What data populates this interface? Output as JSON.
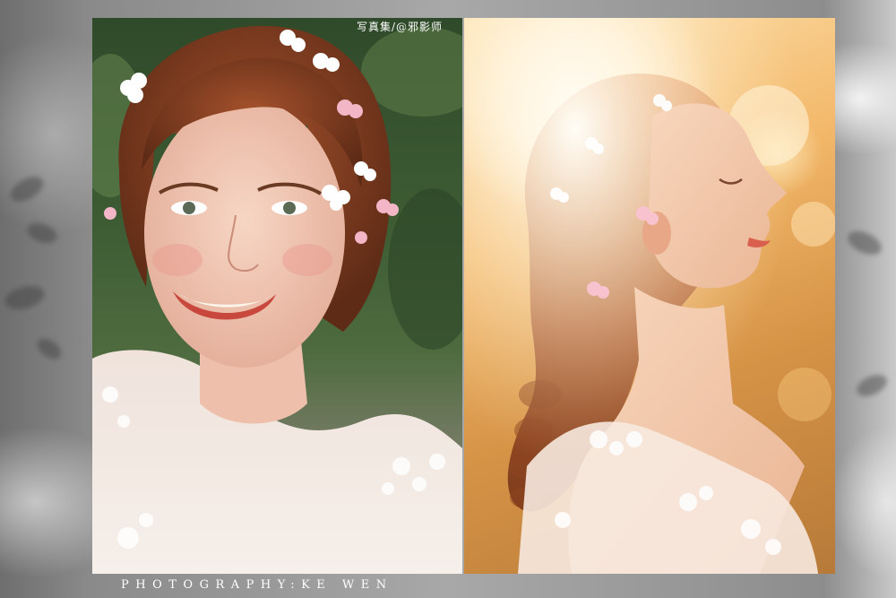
{
  "captions": {
    "top": "写真集/@邪影师",
    "bottom": "PHOTOGRAPHY:KE WEN"
  },
  "colors": {
    "left_photo_tint": "#3c5b33",
    "right_photo_tint": "#f3b86a",
    "background": "#9a9a9a",
    "caption": "#ffffff"
  }
}
